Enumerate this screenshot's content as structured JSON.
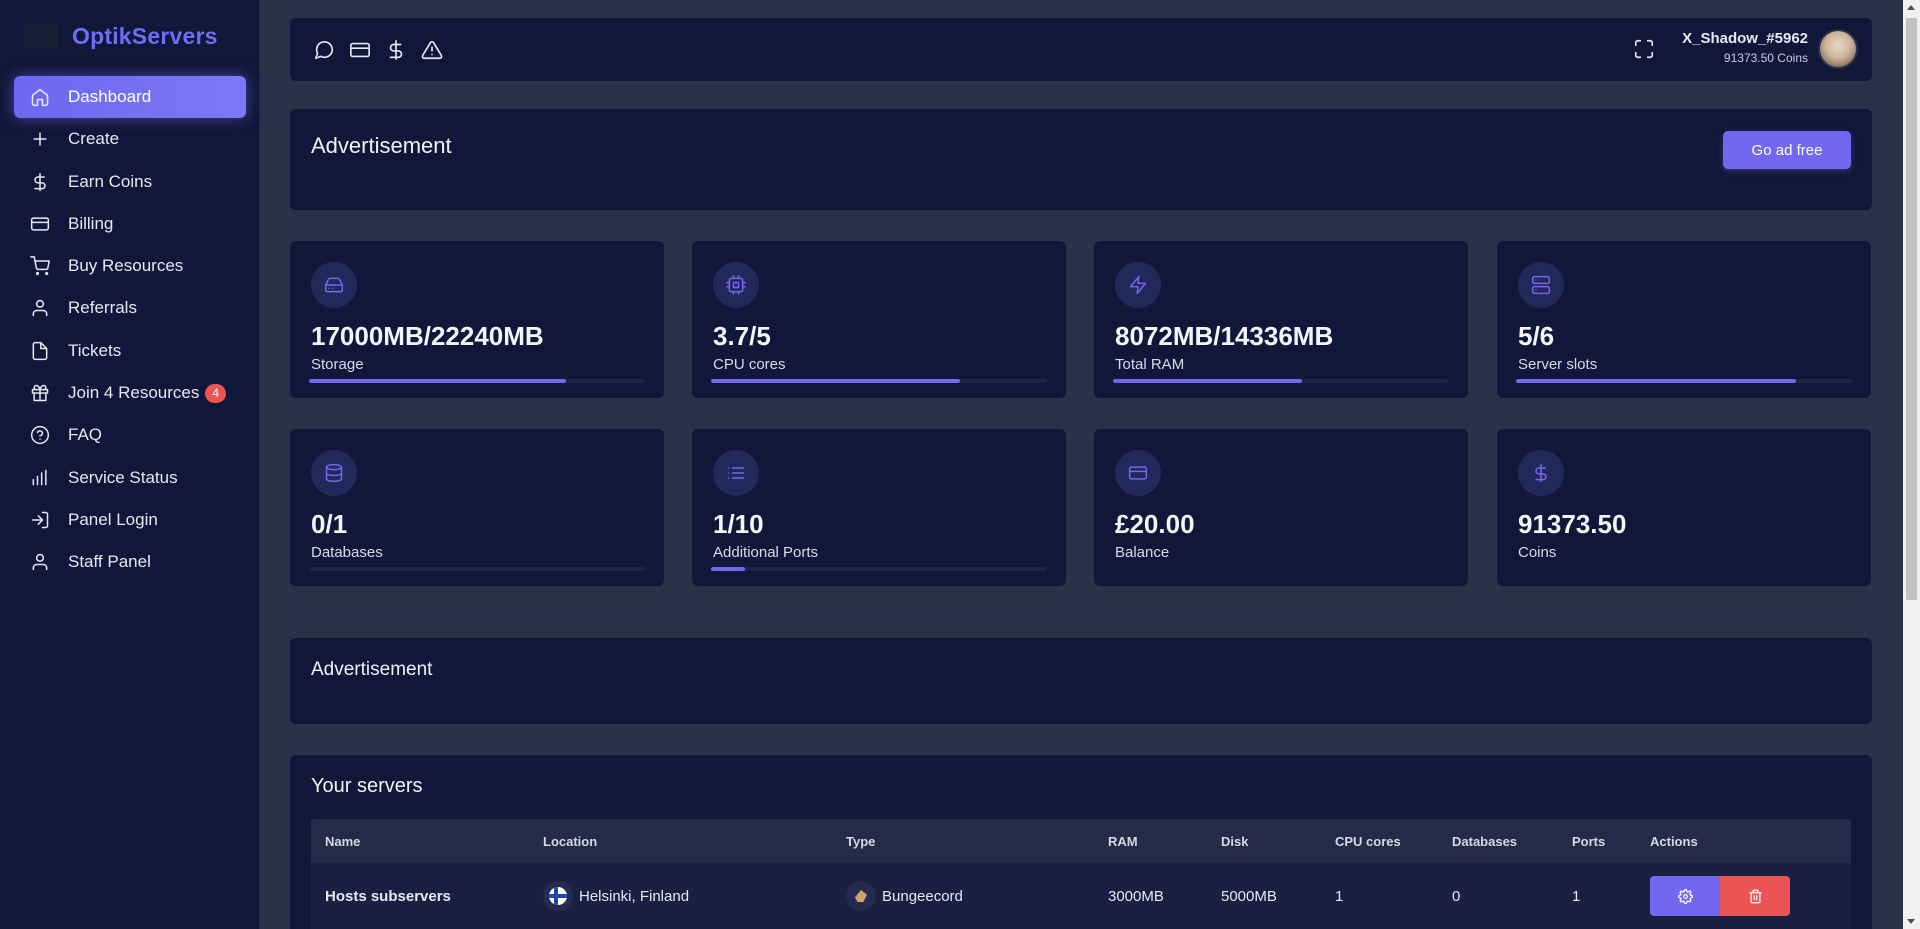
{
  "brand": {
    "name": "OptikServers"
  },
  "sidebar": {
    "items": [
      {
        "label": "Dashboard",
        "icon": "home-icon",
        "active": true
      },
      {
        "label": "Create",
        "icon": "plus-icon"
      },
      {
        "label": "Earn Coins",
        "icon": "dollar-icon"
      },
      {
        "label": "Billing",
        "icon": "credit-card-icon"
      },
      {
        "label": "Buy Resources",
        "icon": "shopping-cart-icon"
      },
      {
        "label": "Referrals",
        "icon": "user-icon"
      },
      {
        "label": "Tickets",
        "icon": "file-icon"
      },
      {
        "label": "Join 4 Resources",
        "icon": "gift-icon",
        "badge": "4"
      },
      {
        "label": "FAQ",
        "icon": "help-circle-icon"
      },
      {
        "label": "Service Status",
        "icon": "bar-chart-icon"
      },
      {
        "label": "Panel Login",
        "icon": "log-in-icon"
      },
      {
        "label": "Staff Panel",
        "icon": "user-icon"
      }
    ]
  },
  "topbar": {
    "icons": [
      "message-circle-icon",
      "credit-card-icon",
      "dollar-icon",
      "alert-triangle-icon"
    ],
    "user": {
      "name": "X_Shadow_#5962",
      "coins": "91373.50 Coins"
    }
  },
  "ad1": {
    "title": "Advertisement",
    "button": "Go ad free"
  },
  "ad2": {
    "title": "Advertisement"
  },
  "stats": [
    {
      "icon": "hard-drive-icon",
      "value": "17000MB/22240MB",
      "label": "Storage",
      "progress": 0.764
    },
    {
      "icon": "cpu-icon",
      "value": "3.7/5",
      "label": "CPU cores",
      "progress": 0.74
    },
    {
      "icon": "zap-icon",
      "value": "8072MB/14336MB",
      "label": "Total RAM",
      "progress": 0.563
    },
    {
      "icon": "server-icon",
      "value": "5/6",
      "label": "Server slots",
      "progress": 0.833
    },
    {
      "icon": "database-icon",
      "value": "0/1",
      "label": "Databases",
      "progress": 0
    },
    {
      "icon": "list-icon",
      "value": "1/10",
      "label": "Additional Ports",
      "progress": 0.1
    },
    {
      "icon": "credit-card-icon",
      "value": "£20.00",
      "label": "Balance"
    },
    {
      "icon": "dollar-icon",
      "value": "91373.50",
      "label": "Coins"
    }
  ],
  "servers": {
    "title": "Your servers",
    "columns": [
      "Name",
      "Location",
      "Type",
      "RAM",
      "Disk",
      "CPU cores",
      "Databases",
      "Ports",
      "Actions"
    ],
    "rows": [
      {
        "name": "Hosts subservers",
        "location": "Helsinki, Finland",
        "type": "Bungeecord",
        "ram": "3000MB",
        "disk": "5000MB",
        "cpu": "1",
        "databases": "0",
        "ports": "1"
      }
    ]
  },
  "colors": {
    "accent": "#7367f0",
    "danger": "#ea5455",
    "card": "#111739",
    "background": "#2a3148"
  }
}
